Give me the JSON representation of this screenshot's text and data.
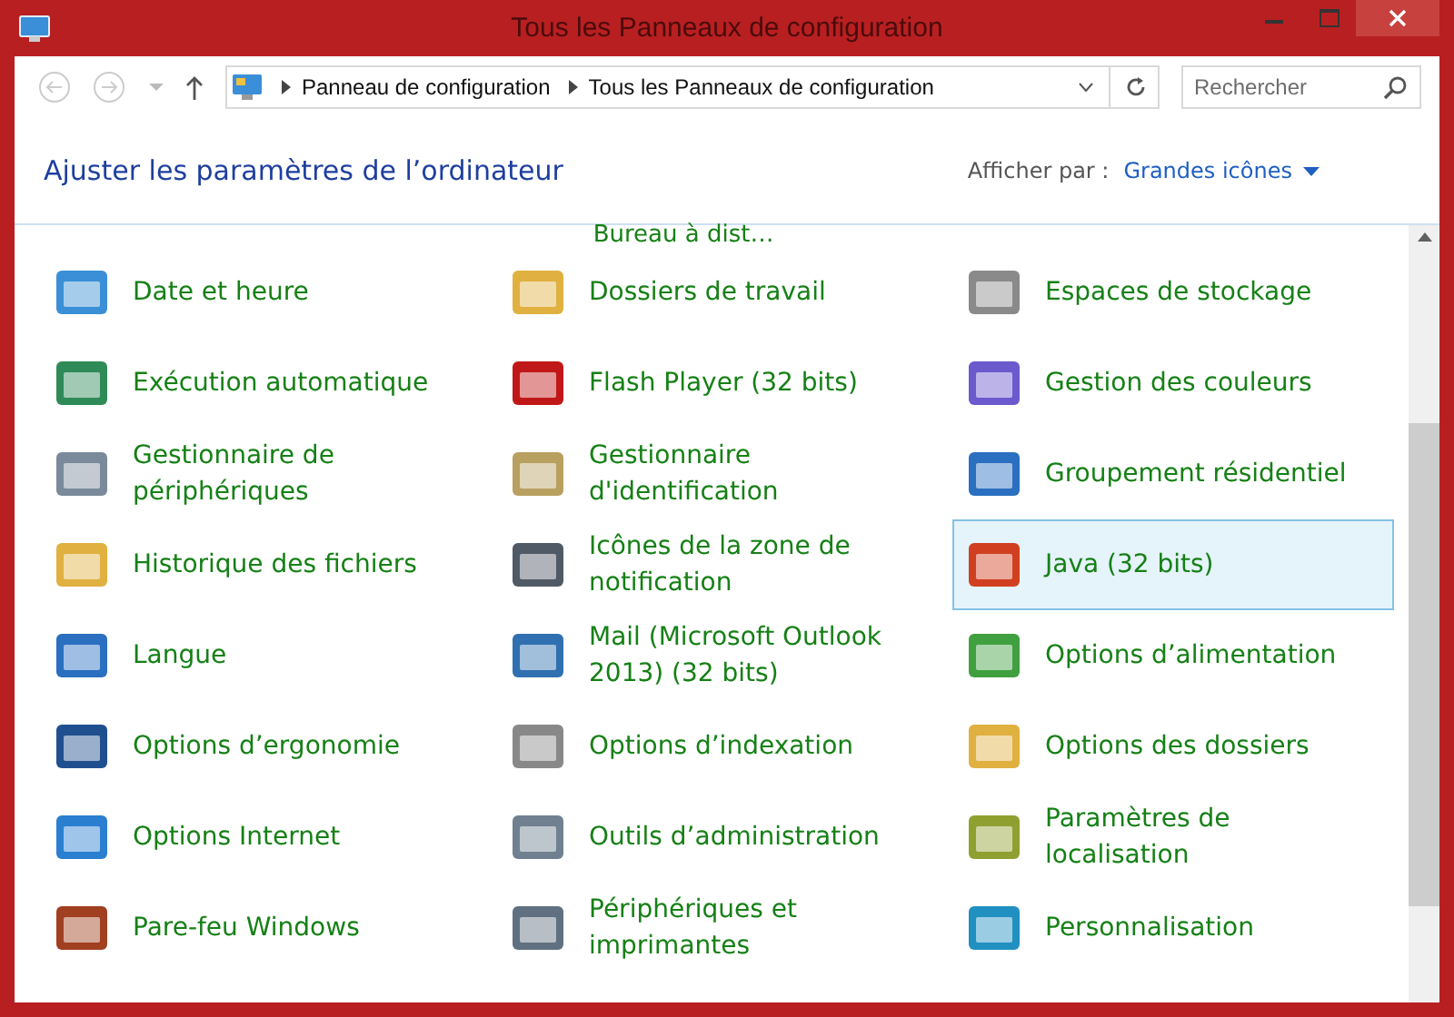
{
  "window": {
    "title": "Tous les Panneaux de configuration"
  },
  "address_bar": {
    "breadcrumbs": [
      "Panneau de configuration",
      "Tous les Panneaux de configuration"
    ]
  },
  "search": {
    "placeholder": "Rechercher"
  },
  "header": {
    "title": "Ajuster les paramètres de l’ordinateur",
    "view_label": "Afficher par :",
    "view_value": "Grandes icônes"
  },
  "partial_item": {
    "label": "Bureau à dist…"
  },
  "items": [
    {
      "label": "Date et heure",
      "selected": false
    },
    {
      "label": "Dossiers de travail",
      "selected": false
    },
    {
      "label": "Espaces de stockage",
      "selected": false
    },
    {
      "label": "Exécution automatique",
      "selected": false
    },
    {
      "label": "Flash Player (32 bits)",
      "selected": false
    },
    {
      "label": "Gestion des couleurs",
      "selected": false
    },
    {
      "label": "Gestionnaire de périphériques",
      "selected": false
    },
    {
      "label": "Gestionnaire d'identification",
      "selected": false
    },
    {
      "label": "Groupement résidentiel",
      "selected": false
    },
    {
      "label": "Historique des fichiers",
      "selected": false
    },
    {
      "label": "Icônes de la zone de notification",
      "selected": false
    },
    {
      "label": "Java (32 bits)",
      "selected": true
    },
    {
      "label": "Langue",
      "selected": false
    },
    {
      "label": "Mail (Microsoft Outlook 2013) (32 bits)",
      "selected": false
    },
    {
      "label": "Options d’alimentation",
      "selected": false
    },
    {
      "label": "Options d’ergonomie",
      "selected": false
    },
    {
      "label": "Options d’indexation",
      "selected": false
    },
    {
      "label": "Options des dossiers",
      "selected": false
    },
    {
      "label": "Options Internet",
      "selected": false
    },
    {
      "label": "Outils d’administration",
      "selected": false
    },
    {
      "label": "Paramètres de localisation",
      "selected": false
    },
    {
      "label": "Pare-feu Windows",
      "selected": false
    },
    {
      "label": "Périphériques et imprimantes",
      "selected": false
    },
    {
      "label": "Personnalisation",
      "selected": false
    }
  ]
}
